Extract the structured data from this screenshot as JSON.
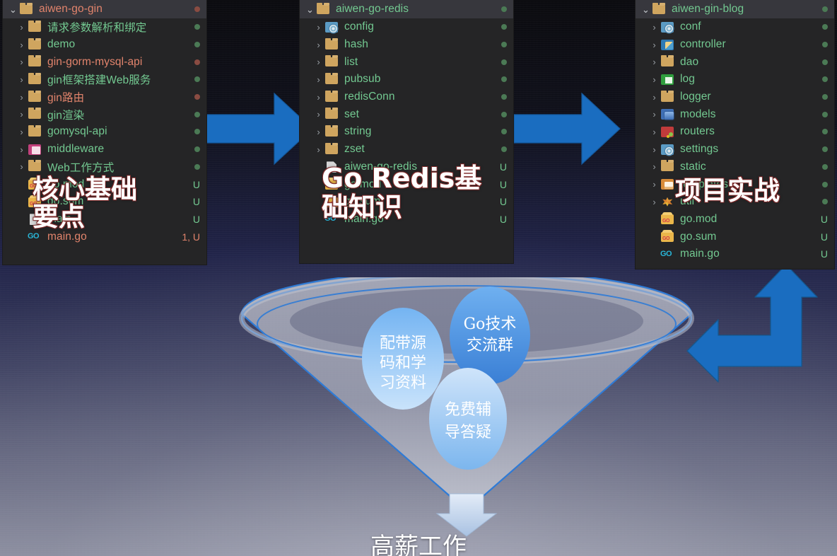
{
  "colors": {
    "arrow_blue": "#1a6dc0",
    "panel_bg": "#252526",
    "text_green": "#73c991",
    "text_modified": "#e2846c",
    "dot_green": "#4b7a55",
    "dot_red": "#8a4c42",
    "caption_white": "#ffffff",
    "caption_outline": "#7e2b2b",
    "bubble_blue": "#4a90e2"
  },
  "panels": [
    {
      "id": "aiwen-go-gin",
      "root": {
        "label": "aiwen-go-gin",
        "chevron": "chevron-down-icon",
        "icon": "folder-icon",
        "state": "modified",
        "badge": "",
        "dot": "red"
      },
      "items": [
        {
          "label": "请求参数解析和绑定",
          "chevron": "chevron-right-icon",
          "icon": "folder-icon",
          "state": "normal",
          "badge": "",
          "dot": "green"
        },
        {
          "label": "demo",
          "chevron": "chevron-right-icon",
          "icon": "folder-icon",
          "state": "normal",
          "badge": "",
          "dot": "green"
        },
        {
          "label": "gin-gorm-mysql-api",
          "chevron": "chevron-right-icon",
          "icon": "folder-icon",
          "state": "modified",
          "badge": "",
          "dot": "red"
        },
        {
          "label": "gin框架搭建Web服务",
          "chevron": "chevron-right-icon",
          "icon": "folder-icon",
          "state": "normal",
          "badge": "",
          "dot": "green"
        },
        {
          "label": "gin路由",
          "chevron": "chevron-right-icon",
          "icon": "folder-icon",
          "state": "modified",
          "badge": "",
          "dot": "red"
        },
        {
          "label": "gin渲染",
          "chevron": "chevron-right-icon",
          "icon": "folder-icon",
          "state": "normal",
          "badge": "",
          "dot": "green"
        },
        {
          "label": "gomysql-api",
          "chevron": "chevron-right-icon",
          "icon": "folder-icon",
          "state": "normal",
          "badge": "",
          "dot": "green"
        },
        {
          "label": "middleware",
          "chevron": "chevron-right-icon",
          "icon": "folder-pink-icon",
          "state": "normal",
          "badge": "",
          "dot": "green"
        },
        {
          "label": "Web工作方式",
          "chevron": "chevron-right-icon",
          "icon": "folder-icon",
          "state": "normal",
          "badge": "",
          "dot": "green"
        },
        {
          "label": "go.mod",
          "chevron": "",
          "icon": "go-mod-icon",
          "state": "normal",
          "badge": "U",
          "dot": ""
        },
        {
          "label": "go.sum",
          "chevron": "",
          "icon": "go-mod-icon",
          "state": "normal",
          "badge": "U",
          "dot": ""
        },
        {
          "label": "main",
          "chevron": "",
          "icon": "file-icon",
          "state": "normal",
          "badge": "U",
          "dot": ""
        },
        {
          "label": "main.go",
          "chevron": "",
          "icon": "go-file-icon",
          "state": "modified",
          "badge": "1, U",
          "dot": ""
        }
      ]
    },
    {
      "id": "aiwen-go-redis",
      "root": {
        "label": "aiwen-go-redis",
        "chevron": "chevron-down-icon",
        "icon": "folder-icon",
        "state": "normal",
        "badge": "",
        "dot": "green"
      },
      "items": [
        {
          "label": "config",
          "chevron": "chevron-right-icon",
          "icon": "folder-gear-icon",
          "state": "normal",
          "badge": "",
          "dot": "green"
        },
        {
          "label": "hash",
          "chevron": "chevron-right-icon",
          "icon": "folder-icon",
          "state": "normal",
          "badge": "",
          "dot": "green"
        },
        {
          "label": "list",
          "chevron": "chevron-right-icon",
          "icon": "folder-icon",
          "state": "normal",
          "badge": "",
          "dot": "green"
        },
        {
          "label": "pubsub",
          "chevron": "chevron-right-icon",
          "icon": "folder-icon",
          "state": "normal",
          "badge": "",
          "dot": "green"
        },
        {
          "label": "redisConn",
          "chevron": "chevron-right-icon",
          "icon": "folder-icon",
          "state": "normal",
          "badge": "",
          "dot": "green"
        },
        {
          "label": "set",
          "chevron": "chevron-right-icon",
          "icon": "folder-icon",
          "state": "normal",
          "badge": "",
          "dot": "green"
        },
        {
          "label": "string",
          "chevron": "chevron-right-icon",
          "icon": "folder-icon",
          "state": "normal",
          "badge": "",
          "dot": "green"
        },
        {
          "label": "zset",
          "chevron": "chevron-right-icon",
          "icon": "folder-icon",
          "state": "normal",
          "badge": "",
          "dot": "green"
        },
        {
          "label": "aiwen-go-redis",
          "chevron": "",
          "icon": "file-icon",
          "state": "normal",
          "badge": "U",
          "dot": ""
        },
        {
          "label": "go.mod",
          "chevron": "",
          "icon": "go-mod-icon",
          "state": "normal",
          "badge": "U",
          "dot": ""
        },
        {
          "label": "go.sum",
          "chevron": "",
          "icon": "go-mod-icon",
          "state": "normal",
          "badge": "U",
          "dot": ""
        },
        {
          "label": "main.go",
          "chevron": "",
          "icon": "go-file-icon",
          "state": "normal",
          "badge": "U",
          "dot": ""
        }
      ]
    },
    {
      "id": "aiwen-gin-blog",
      "root": {
        "label": "aiwen-gin-blog",
        "chevron": "chevron-down-icon",
        "icon": "folder-icon",
        "state": "normal",
        "badge": "",
        "dot": "green"
      },
      "items": [
        {
          "label": "conf",
          "chevron": "chevron-right-icon",
          "icon": "folder-gear-icon",
          "state": "normal",
          "badge": "",
          "dot": "green"
        },
        {
          "label": "controller",
          "chevron": "chevron-right-icon",
          "icon": "folder-controller-icon",
          "state": "normal",
          "badge": "",
          "dot": "green"
        },
        {
          "label": "dao",
          "chevron": "chevron-right-icon",
          "icon": "folder-icon",
          "state": "normal",
          "badge": "",
          "dot": "green"
        },
        {
          "label": "log",
          "chevron": "chevron-right-icon",
          "icon": "folder-green-icon",
          "state": "normal",
          "badge": "",
          "dot": "green"
        },
        {
          "label": "logger",
          "chevron": "chevron-right-icon",
          "icon": "folder-icon",
          "state": "normal",
          "badge": "",
          "dot": "green"
        },
        {
          "label": "models",
          "chevron": "chevron-right-icon",
          "icon": "folder-blue-icon",
          "state": "normal",
          "badge": "",
          "dot": "green"
        },
        {
          "label": "routers",
          "chevron": "chevron-right-icon",
          "icon": "folder-red-icon",
          "state": "normal",
          "badge": "",
          "dot": "green"
        },
        {
          "label": "settings",
          "chevron": "chevron-right-icon",
          "icon": "folder-gear-icon",
          "state": "normal",
          "badge": "",
          "dot": "green"
        },
        {
          "label": "static",
          "chevron": "chevron-right-icon",
          "icon": "folder-icon",
          "state": "normal",
          "badge": "",
          "dot": "green"
        },
        {
          "label": "templates",
          "chevron": "chevron-right-icon",
          "icon": "folder-template-icon",
          "state": "normal",
          "badge": "",
          "dot": "green"
        },
        {
          "label": "util",
          "chevron": "chevron-right-icon",
          "icon": "folder-util-icon",
          "state": "normal",
          "badge": "",
          "dot": "green"
        },
        {
          "label": "go.mod",
          "chevron": "",
          "icon": "go-mod-icon",
          "state": "normal",
          "badge": "U",
          "dot": ""
        },
        {
          "label": "go.sum",
          "chevron": "",
          "icon": "go-mod-icon",
          "state": "normal",
          "badge": "U",
          "dot": ""
        },
        {
          "label": "main.go",
          "chevron": "",
          "icon": "go-file-icon",
          "state": "normal",
          "badge": "U",
          "dot": ""
        }
      ]
    }
  ],
  "captions": {
    "left": "核心基础\n要点",
    "middle_latin": "Go Redis",
    "middle_cjk": "基\n础知识",
    "right": "项目实战",
    "bottom": "高薪工作"
  },
  "arrows": [
    {
      "name": "arrow-left-to-middle",
      "direction": "right"
    },
    {
      "name": "arrow-middle-to-right",
      "direction": "right"
    },
    {
      "name": "arrow-elbow-up-left",
      "direction": "up-left"
    },
    {
      "name": "arrow-funnel-output",
      "direction": "down"
    }
  ],
  "funnel": {
    "bubbles": [
      {
        "name": "bubble-source-code",
        "lines": [
          "配带源",
          "码和学",
          "习资料"
        ]
      },
      {
        "name": "bubble-go-group",
        "lines": [
          "Go技术",
          "交流群"
        ]
      },
      {
        "name": "bubble-free-support",
        "lines": [
          "免费辅",
          "导答疑"
        ]
      }
    ]
  }
}
